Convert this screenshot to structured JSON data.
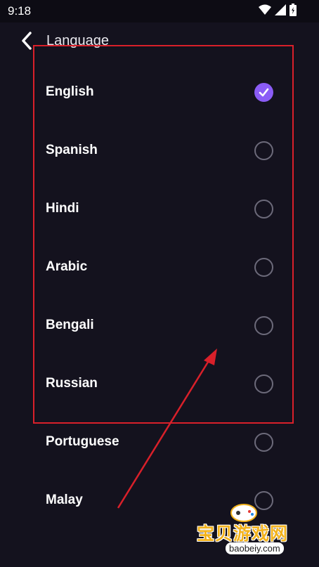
{
  "status_bar": {
    "time": "9:18",
    "icons": [
      "wifi-icon",
      "cellular-signal-icon",
      "battery-charging-icon"
    ]
  },
  "header": {
    "title": "Language",
    "back_icon": "chevron-left-icon"
  },
  "languages": [
    {
      "label": "English",
      "selected": true
    },
    {
      "label": "Spanish",
      "selected": false
    },
    {
      "label": "Hindi",
      "selected": false
    },
    {
      "label": "Arabic",
      "selected": false
    },
    {
      "label": "Bengali",
      "selected": false
    },
    {
      "label": "Russian",
      "selected": false
    },
    {
      "label": "Portuguese",
      "selected": false
    },
    {
      "label": "Malay",
      "selected": false
    }
  ],
  "watermark": {
    "name": "宝贝游戏网",
    "url": "baobeiy.com"
  },
  "colors": {
    "background": "#14121e",
    "accent": "#8b5cf6",
    "annotation": "#d9202a"
  }
}
